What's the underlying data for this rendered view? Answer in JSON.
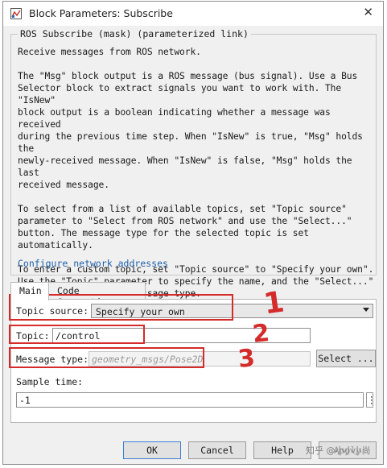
{
  "window": {
    "title": "Block Parameters: Subscribe",
    "close_glyph": "✕"
  },
  "mask_group": {
    "label": "ROS Subscribe (mask) (parameterized link)",
    "description": "Receive messages from ROS network.\n\nThe \"Msg\" block output is a ROS message (bus signal). Use a Bus\nSelector block to extract signals you want to work with. The \"IsNew\"\nblock output is a boolean indicating whether a message was received\nduring the previous time step. When \"IsNew\" is true, \"Msg\" holds the\nnewly-received message. When \"IsNew\" is false, \"Msg\" holds the last\nreceived message.\n\nTo select from a list of available topics, set \"Topic source\"\nparameter to \"Select from ROS network\" and use the \"Select...\"\nbutton. The message type for the selected topic is set\nautomatically.\n\nTo enter a custom topic, set \"Topic source\" to \"Specify your own\".\nUse the \"Topic\" parameter to specify the name, and the \"Select...\"\nbutton to select the message type.",
    "link": "Configure network addresses"
  },
  "tabs": [
    {
      "label": "Main",
      "active": true
    },
    {
      "label": "Code Generation",
      "active": false
    }
  ],
  "params": {
    "topic_source_label": "Topic source:",
    "topic_source_value": "Specify your own",
    "topic_label": "Topic:",
    "topic_value": "/control",
    "message_type_label": "Message type:",
    "message_type_value": "geometry_msgs/Pose2D",
    "select_button": "Select ...",
    "sample_time_label": "Sample time:",
    "sample_time_value": "-1",
    "more_glyph": "⋮"
  },
  "buttons": {
    "ok": "OK",
    "cancel": "Cancel",
    "help": "Help",
    "apply": "Apply"
  },
  "annotations": {
    "numbers": [
      "1",
      "2",
      "3"
    ],
    "color": "#d42b2b"
  },
  "watermark": "知乎 @小小小尚",
  "icons": [
    "simulink-block-icon",
    "close-icon",
    "chevron-down-icon",
    "more-options-icon"
  ]
}
